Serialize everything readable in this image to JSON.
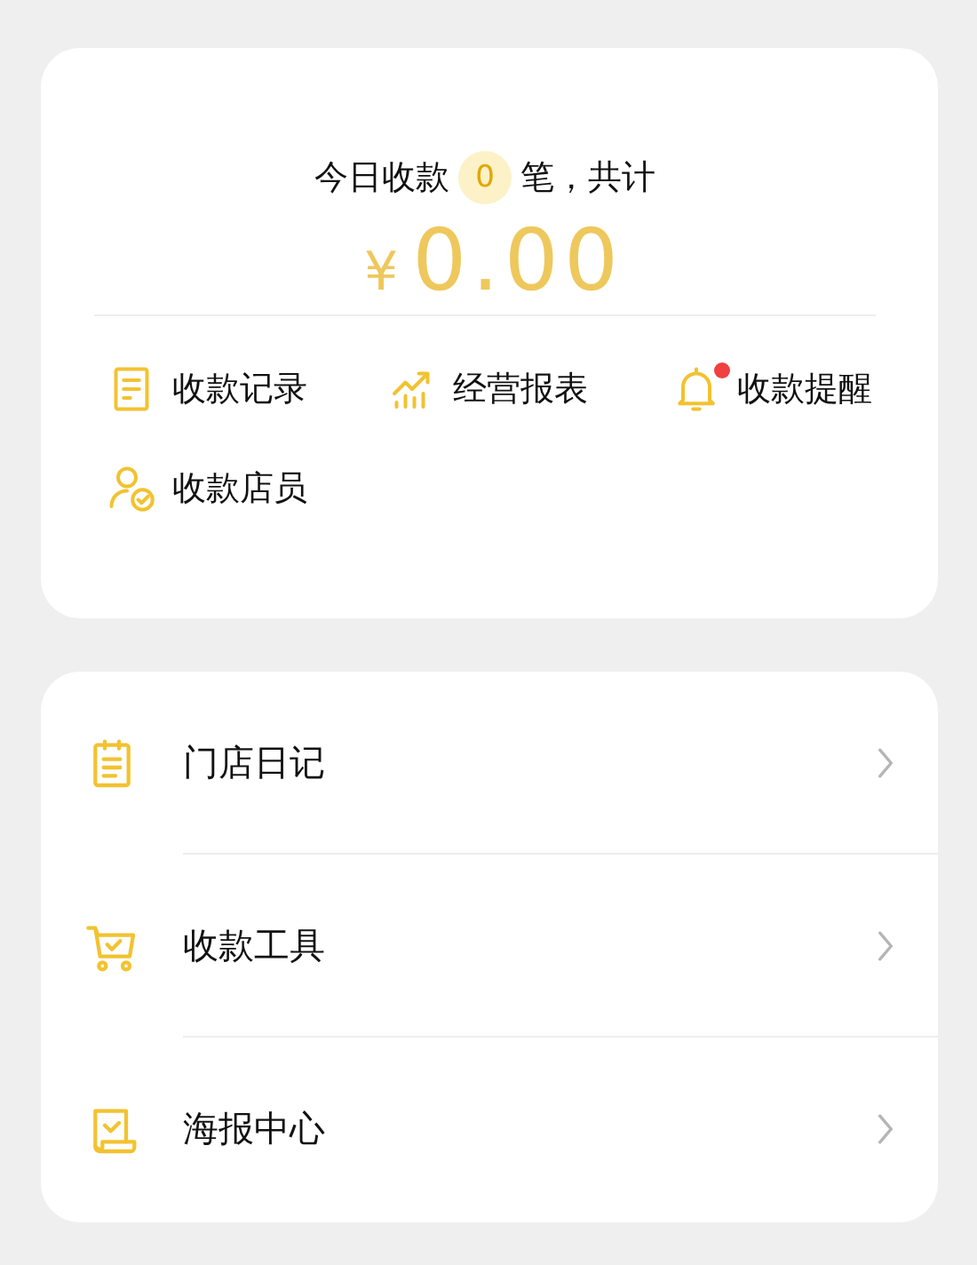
{
  "summary": {
    "prefix": "今日收款",
    "count": "0",
    "suffix": "笔，共计",
    "currency": "¥",
    "amount": "0.00"
  },
  "actions": [
    {
      "kind": "record",
      "label": "收款记录",
      "badge": false
    },
    {
      "kind": "report",
      "label": "经营报表",
      "badge": false
    },
    {
      "kind": "bell",
      "label": "收款提醒",
      "badge": true
    },
    {
      "kind": "staff",
      "label": "收款店员",
      "badge": false
    }
  ],
  "menu": [
    {
      "kind": "diary",
      "label": "门店日记"
    },
    {
      "kind": "cart",
      "label": "收款工具"
    },
    {
      "kind": "poster",
      "label": "海报中心"
    }
  ]
}
